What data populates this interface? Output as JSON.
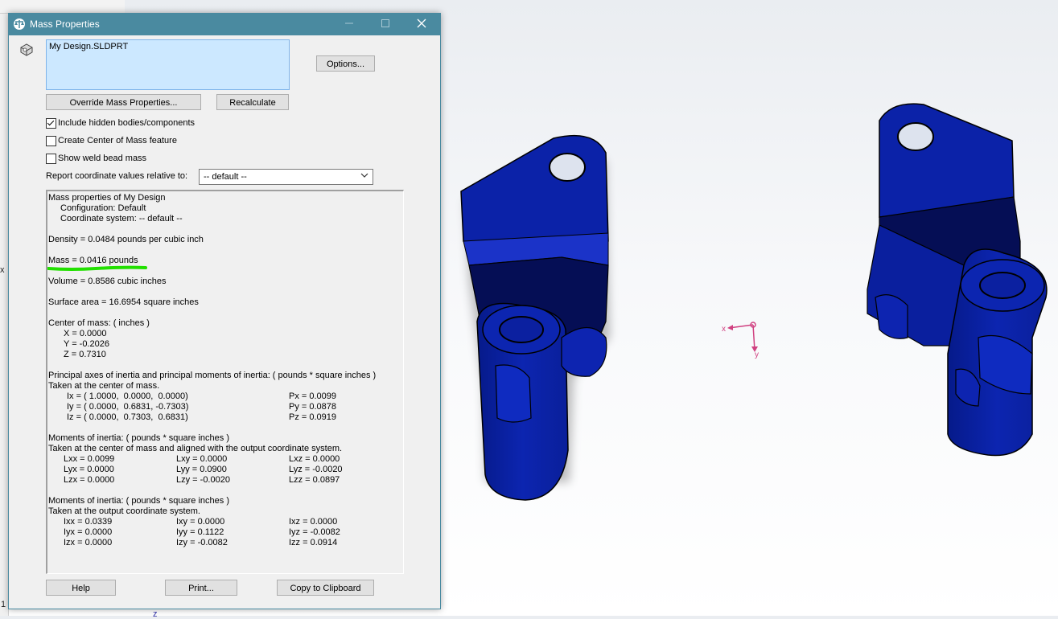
{
  "dialog": {
    "title": "Mass Properties",
    "file_item": "My Design.SLDPRT",
    "buttons": {
      "options": "Options...",
      "override": "Override Mass Properties...",
      "recalculate": "Recalculate",
      "help": "Help",
      "print": "Print...",
      "copy": "Copy to Clipboard"
    },
    "checkboxes": [
      {
        "label": "Include hidden bodies/components",
        "checked": true
      },
      {
        "label": "Create Center of Mass feature",
        "checked": false
      },
      {
        "label": "Show weld bead mass",
        "checked": false
      }
    ],
    "report_label": "Report coordinate values relative to:",
    "report_value": "-- default --"
  },
  "results": {
    "header": "Mass properties of My Design",
    "config": "Configuration: Default",
    "coord": "Coordinate system: -- default --",
    "density": "Density = 0.0484 pounds per cubic inch",
    "mass": "Mass = 0.0416 pounds",
    "volume": "Volume = 0.8586 cubic inches",
    "surface": "Surface area = 16.6954 square inches",
    "com_title": "Center of mass: ( inches )",
    "com": [
      "X = 0.0000",
      "Y = -0.2026",
      "Z = 0.7310"
    ],
    "principal_title": "Principal axes of inertia and principal moments of inertia: ( pounds * square inches )",
    "principal_sub": "Taken at the center of mass.",
    "principal": [
      {
        "axis": "Ix = ( 1.0000,  0.0000,  0.0000)",
        "moment": "Px = 0.0099"
      },
      {
        "axis": "Iy = ( 0.0000,  0.6831, -0.7303)",
        "moment": "Py = 0.0878"
      },
      {
        "axis": "Iz = ( 0.0000,  0.7303,  0.6831)",
        "moment": "Pz = 0.0919"
      }
    ],
    "moi1_title": "Moments of inertia: ( pounds * square inches )",
    "moi1_sub": "Taken at the center of mass and aligned with the output coordinate system.",
    "moi1": [
      [
        "Lxx = 0.0099",
        "Lxy = 0.0000",
        "Lxz = 0.0000"
      ],
      [
        "Lyx = 0.0000",
        "Lyy = 0.0900",
        "Lyz = -0.0020"
      ],
      [
        "Lzx = 0.0000",
        "Lzy = -0.0020",
        "Lzz = 0.0897"
      ]
    ],
    "moi2_title": "Moments of inertia: ( pounds * square inches )",
    "moi2_sub": "Taken at the output coordinate system.",
    "moi2": [
      [
        "Ixx = 0.0339",
        "Ixy = 0.0000",
        "Ixz = 0.0000"
      ],
      [
        "Iyx = 0.0000",
        "Iyy = 0.1122",
        "Iyz = -0.0082"
      ],
      [
        "Izx = 0.0000",
        "Izy = -0.0082",
        "Izz = 0.0914"
      ]
    ]
  },
  "triad": {
    "x_label": "x",
    "y_label": "y"
  },
  "edge": {
    "glyph_left": "x",
    "glyph_bottom": "1",
    "glyph_z": "z"
  },
  "colors": {
    "titlebar": "#4a8aa0",
    "part": "#0a1e9e",
    "highlight": "#22e000",
    "triad": "#d04080"
  }
}
